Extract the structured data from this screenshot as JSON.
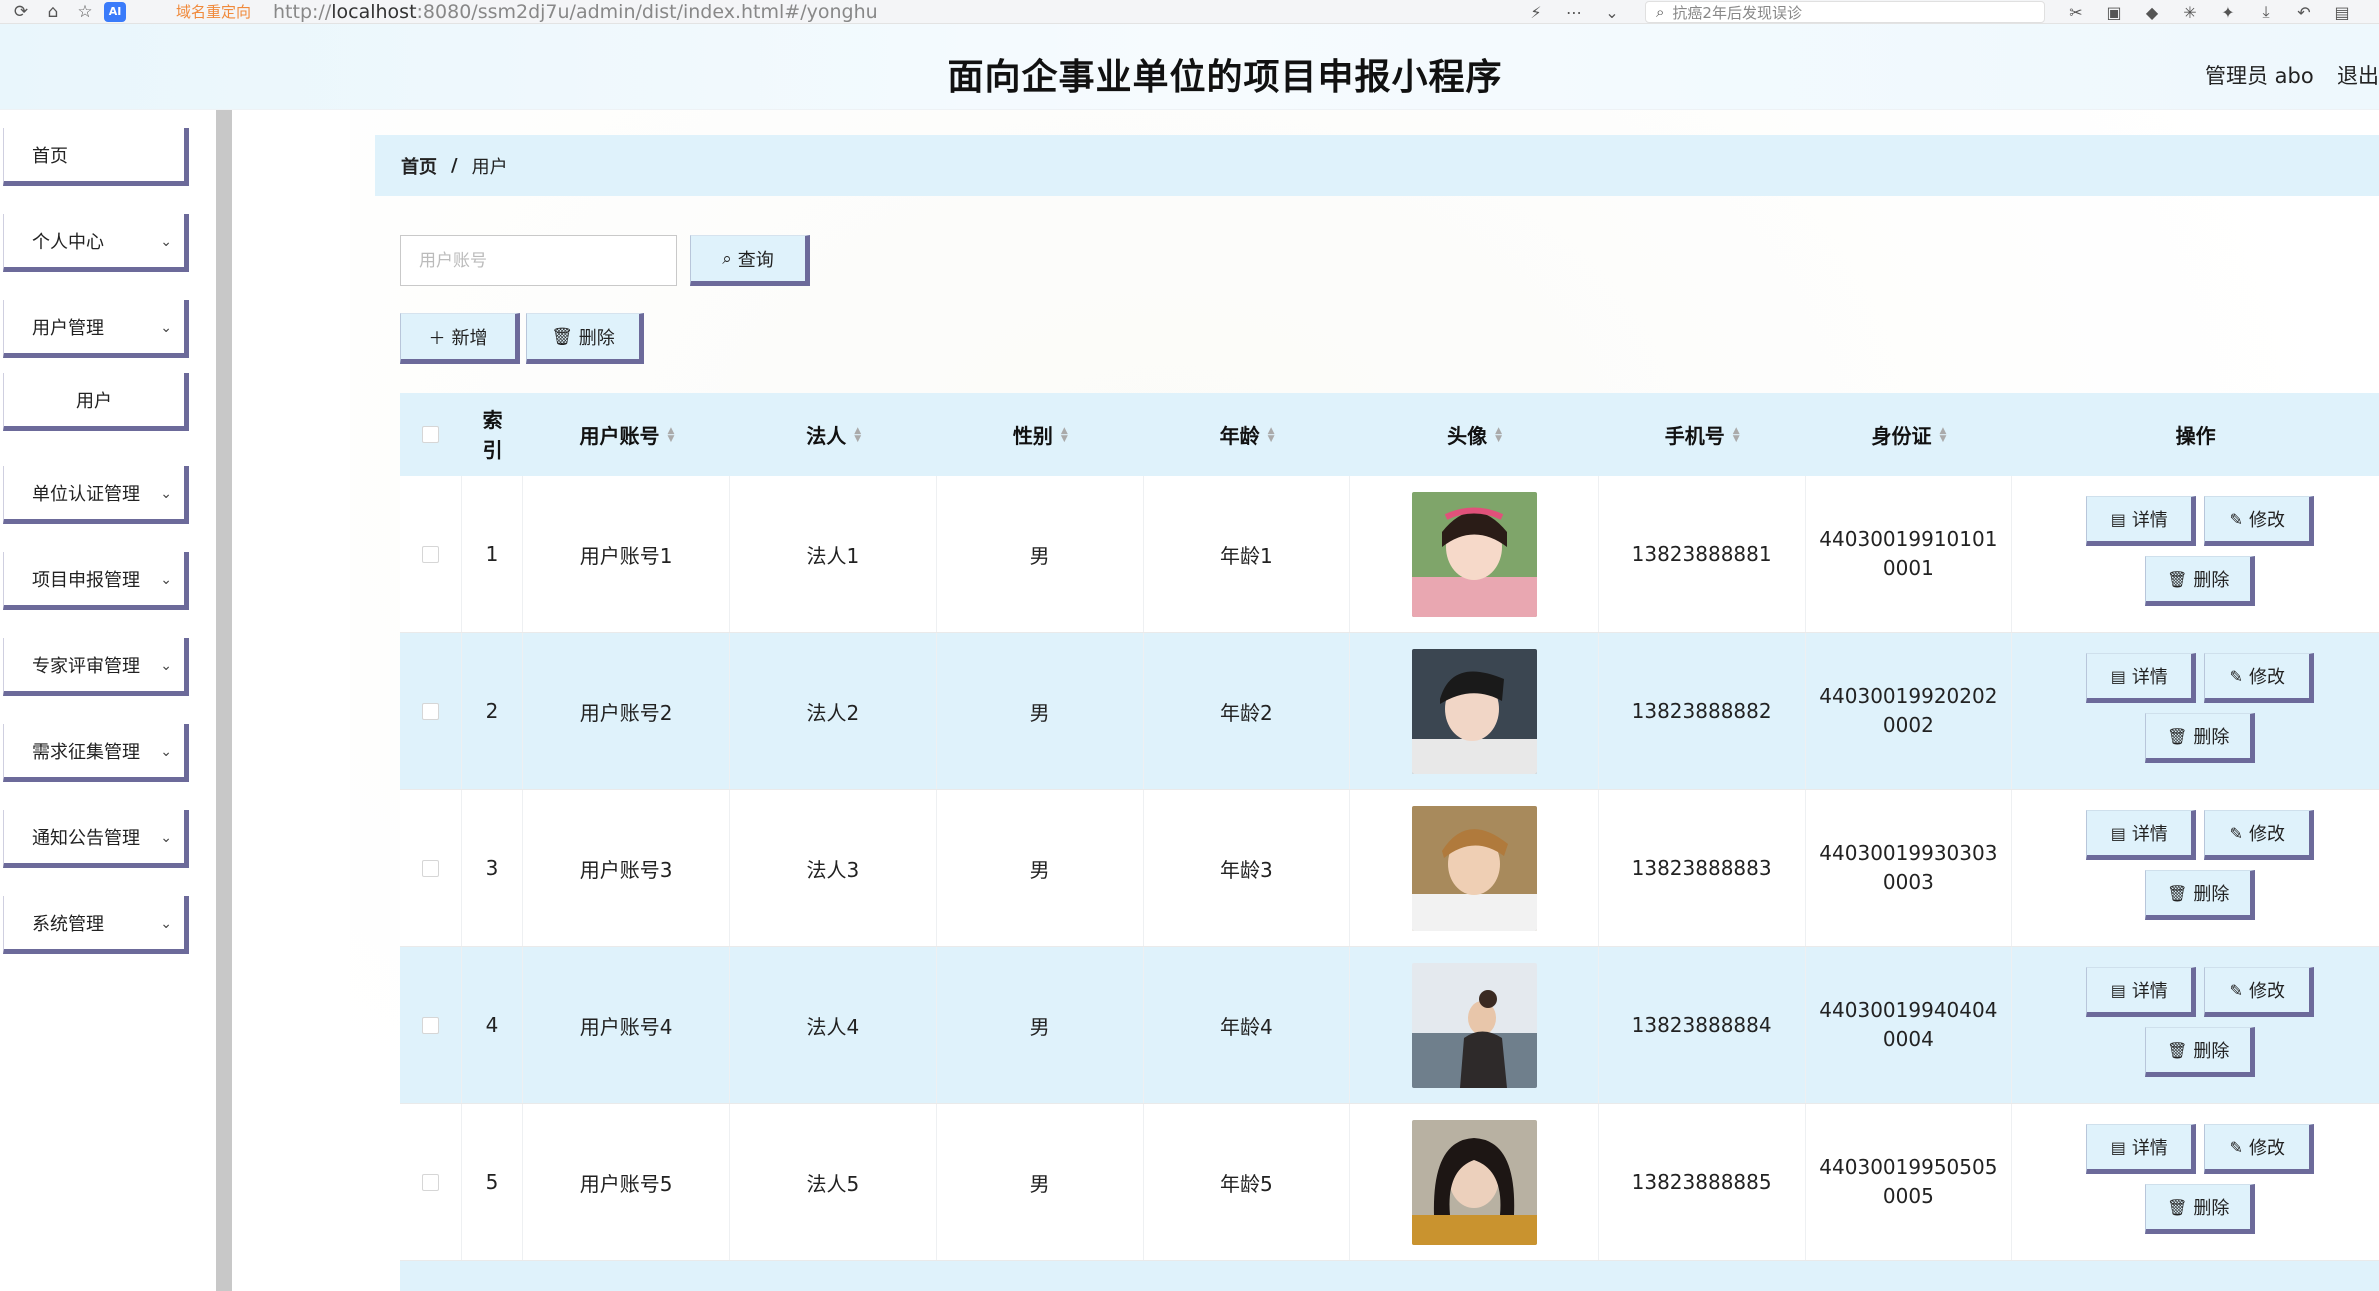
{
  "browser": {
    "redirect_label": "域名重定向",
    "url_prefix": "http://",
    "url_host": "localhost",
    "url_rest": ":8080/ssm2dj7u/admin/dist/index.html#/yonghu",
    "search_text": "抗癌2年后发现误诊"
  },
  "header": {
    "title": "面向企事业单位的项目申报小程序",
    "user": "管理员 abo",
    "logout": "退出"
  },
  "sidebar": {
    "items": [
      {
        "label": "首页"
      },
      {
        "label": "个人中心"
      },
      {
        "label": "用户管理"
      },
      {
        "label": "用户"
      },
      {
        "label": "单位认证管理"
      },
      {
        "label": "项目申报管理"
      },
      {
        "label": "专家评审管理"
      },
      {
        "label": "需求征集管理"
      },
      {
        "label": "通知公告管理"
      },
      {
        "label": "系统管理"
      }
    ]
  },
  "breadcrumb": {
    "home": "首页",
    "sep": "/",
    "current": "用户"
  },
  "search": {
    "placeholder": "用户账号",
    "button": "查询"
  },
  "actions": {
    "add": "新增",
    "delete": "删除"
  },
  "table": {
    "headers": {
      "index": "索引",
      "account": "用户账号",
      "legal": "法人",
      "gender": "性别",
      "age": "年龄",
      "avatar": "头像",
      "phone": "手机号",
      "idcard": "身份证",
      "ops": "操作"
    },
    "op_labels": {
      "detail": "详情",
      "edit": "修改",
      "delete": "删除"
    },
    "rows": [
      {
        "index": "1",
        "account": "用户账号1",
        "legal": "法人1",
        "gender": "男",
        "age": "年龄1",
        "phone": "13823888881",
        "idcard": "440300199101010001"
      },
      {
        "index": "2",
        "account": "用户账号2",
        "legal": "法人2",
        "gender": "男",
        "age": "年龄2",
        "phone": "13823888882",
        "idcard": "440300199202020002"
      },
      {
        "index": "3",
        "account": "用户账号3",
        "legal": "法人3",
        "gender": "男",
        "age": "年龄3",
        "phone": "13823888883",
        "idcard": "440300199303030003"
      },
      {
        "index": "4",
        "account": "用户账号4",
        "legal": "法人4",
        "gender": "男",
        "age": "年龄4",
        "phone": "13823888884",
        "idcard": "440300199404040004"
      },
      {
        "index": "5",
        "account": "用户账号5",
        "legal": "法人5",
        "gender": "男",
        "age": "年龄5",
        "phone": "13823888885",
        "idcard": "440300199505050005"
      }
    ]
  },
  "colors": {
    "accent": "#6c6a9a",
    "highlight": "#dff2fb"
  }
}
